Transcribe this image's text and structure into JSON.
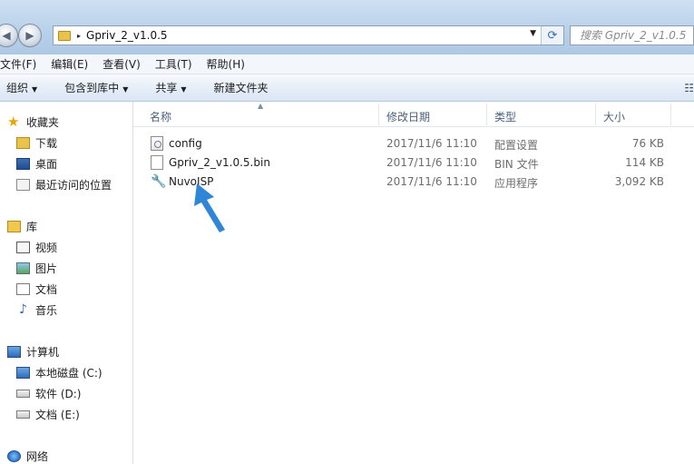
{
  "address": {
    "path": "Gpriv_2_v1.0.5",
    "sep_glyph": "▸",
    "dropdown_glyph": "▼",
    "refresh_glyph": "⟳"
  },
  "search": {
    "placeholder": "搜索 Gpriv_2_v1.0.5"
  },
  "nav_buttons": {
    "back_glyph": "◀",
    "forward_glyph": "▶"
  },
  "menu": [
    "文件(F)",
    "编辑(E)",
    "查看(V)",
    "工具(T)",
    "帮助(H)"
  ],
  "toolbar": {
    "organize": "组织",
    "include_library": "包含到库中",
    "share": "共享",
    "new_folder": "新建文件夹",
    "arrow": "▼",
    "view_glyph": "☷"
  },
  "navigation": {
    "favorites": {
      "label": "收藏夹",
      "items": [
        "下载",
        "桌面",
        "最近访问的位置"
      ]
    },
    "libraries": {
      "label": "库",
      "items": [
        "视频",
        "图片",
        "文档",
        "音乐"
      ]
    },
    "computer": {
      "label": "计算机",
      "items": [
        "本地磁盘 (C:)",
        "软件 (D:)",
        "文档 (E:)"
      ]
    },
    "network": {
      "label": "网络"
    }
  },
  "columns": {
    "name": "名称",
    "modified": "修改日期",
    "type": "类型",
    "size": "大小",
    "sort_glyph": "▲"
  },
  "files": [
    {
      "name": "config",
      "modified": "2017/11/6 11:10",
      "type": "配置设置",
      "size": "76 KB",
      "icon": "config-file-icon"
    },
    {
      "name": "Gpriv_2_v1.0.5.bin",
      "modified": "2017/11/6 11:10",
      "type": "BIN 文件",
      "size": "114 KB",
      "icon": "bin-file-icon"
    },
    {
      "name": "NuvoISP",
      "modified": "2017/11/6 11:10",
      "type": "应用程序",
      "size": "3,092 KB",
      "icon": "application-icon"
    }
  ],
  "colors": {
    "accent": "#2f86d8",
    "header_text": "#4c607a"
  }
}
